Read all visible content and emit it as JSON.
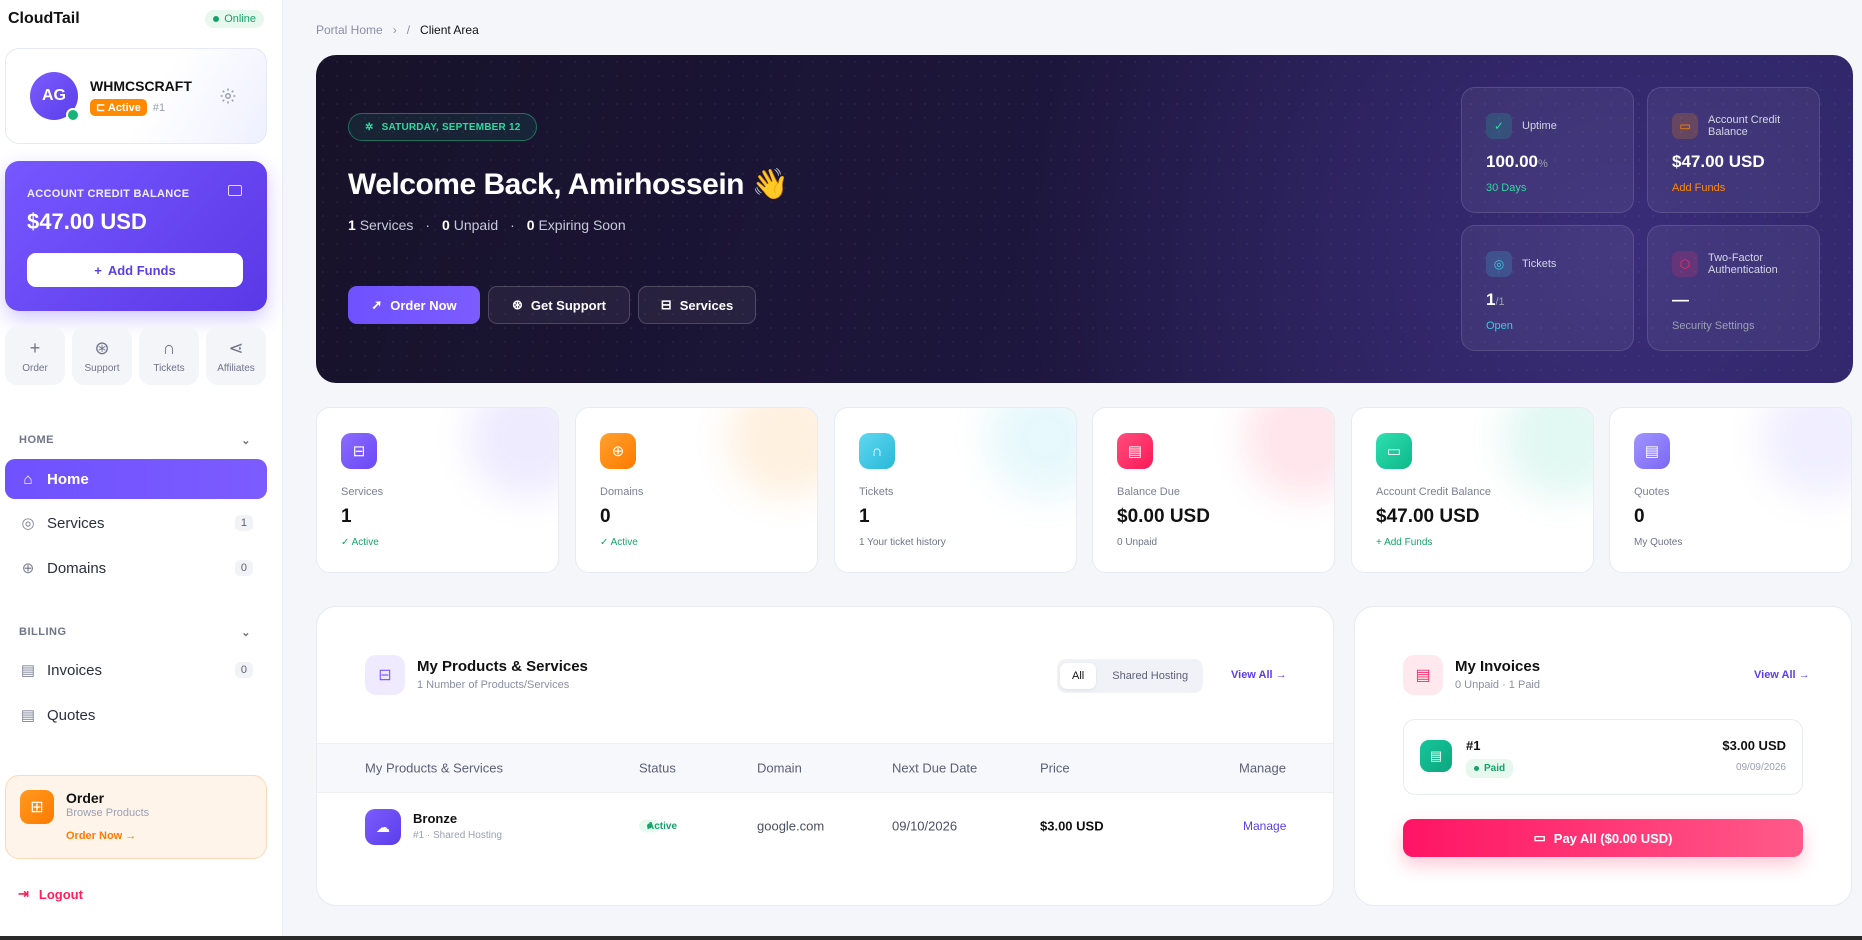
{
  "brand": "CloudTail",
  "status": "Online",
  "profile": {
    "initials": "AG",
    "name": "WHMCSCRAFT",
    "badge": "Active",
    "id": "#1"
  },
  "credit": {
    "label": "ACCOUNT CREDIT BALANCE",
    "amount": "$47.00 USD",
    "button": "Add Funds"
  },
  "quick": [
    {
      "label": "Order",
      "icon": "plus-icon"
    },
    {
      "label": "Support",
      "icon": "lifebuoy-icon"
    },
    {
      "label": "Tickets",
      "icon": "headset-icon"
    },
    {
      "label": "Affiliates",
      "icon": "share-icon"
    }
  ],
  "nav": {
    "home_section": "HOME",
    "home": "Home",
    "services": "Services",
    "services_count": "1",
    "domains": "Domains",
    "domains_count": "0",
    "billing_section": "BILLING",
    "invoices": "Invoices",
    "invoices_count": "0",
    "quotes": "Quotes"
  },
  "order_box": {
    "title": "Order",
    "subtitle": "Browse Products",
    "link": "Order Now →"
  },
  "logout": "Logout",
  "breadcrumb": {
    "home": "Portal Home",
    "sep": "›",
    "slash": "/",
    "current": "Client Area"
  },
  "hero": {
    "date": "SATURDAY, SEPTEMBER 12",
    "welcome": "Welcome Back, Amirhossein 👋",
    "stats": {
      "services_n": "1",
      "services": "Services",
      "unpaid_n": "0",
      "unpaid": "Unpaid",
      "expiring_n": "0",
      "expiring": "Expiring Soon"
    },
    "buttons": {
      "order": "Order Now",
      "support": "Get Support",
      "services": "Services"
    },
    "cards": {
      "uptime": {
        "label": "Uptime",
        "value": "100.00",
        "unit": "%",
        "sub": "30 Days"
      },
      "credit": {
        "label": "Account Credit Balance",
        "value": "$47.00 USD",
        "sub": "Add Funds"
      },
      "tickets": {
        "label": "Tickets",
        "value": "1",
        "unit": "/1",
        "sub": "Open"
      },
      "twofa": {
        "label": "Two-Factor Authentication",
        "value": "—",
        "sub": "Security Settings"
      }
    }
  },
  "stats": [
    {
      "label": "Services",
      "value": "1",
      "sub": "✓ Active",
      "color": "#7b5cff"
    },
    {
      "label": "Domains",
      "value": "0",
      "sub": "✓ Active",
      "color": "#ff8a00"
    },
    {
      "label": "Tickets",
      "value": "1",
      "sub": "1 Your ticket history",
      "color": "#3ec9e6"
    },
    {
      "label": "Balance Due",
      "value": "$0.00 USD",
      "sub": "0 Unpaid",
      "color": "#ff2a66"
    },
    {
      "label": "Account Credit Balance",
      "value": "$47.00 USD",
      "sub": "+ Add Funds",
      "color": "#16c79a"
    },
    {
      "label": "Quotes",
      "value": "0",
      "sub": "My Quotes",
      "color": "#8a7bff"
    }
  ],
  "products": {
    "title": "My Products & Services",
    "subtitle": "1 Number of Products/Services",
    "filters": [
      "All",
      "Shared Hosting"
    ],
    "view_all": "View All →",
    "columns": [
      "My Products & Services",
      "Status",
      "Domain",
      "Next Due Date",
      "Price",
      "Manage"
    ],
    "rows": [
      {
        "name": "Bronze",
        "sub": "#1 · Shared Hosting",
        "status": "Active",
        "domain": "google.com",
        "due": "09/10/2026",
        "price": "$3.00 USD",
        "manage": "Manage"
      }
    ]
  },
  "invoices": {
    "title": "My Invoices",
    "subtitle": "0 Unpaid · 1 Paid",
    "view_all": "View All →",
    "item": {
      "num": "#1",
      "status": "Paid",
      "amount": "$3.00 USD",
      "date": "09/09/2026"
    },
    "pay_all": "Pay All ($0.00 USD)"
  }
}
